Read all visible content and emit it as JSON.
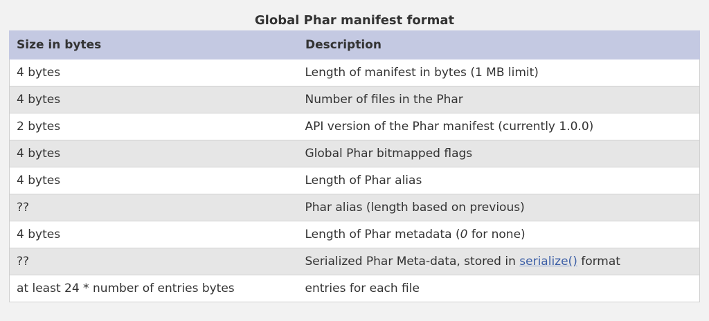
{
  "caption": "Global Phar manifest format",
  "columns": {
    "size": "Size in bytes",
    "description": "Description"
  },
  "rows": [
    {
      "size": "4 bytes",
      "description": "Length of manifest in bytes (1 MB limit)"
    },
    {
      "size": "4 bytes",
      "description": "Number of files in the Phar"
    },
    {
      "size": "2 bytes",
      "description": "API version of the Phar manifest (currently 1.0.0)"
    },
    {
      "size": "4 bytes",
      "description": "Global Phar bitmapped flags"
    },
    {
      "size": "4 bytes",
      "description": "Length of Phar alias"
    },
    {
      "size": "??",
      "description": "Phar alias (length based on previous)"
    },
    {
      "size": "4 bytes",
      "description_before": "Length of Phar metadata (",
      "description_em": "0",
      "description_after": " for none)"
    },
    {
      "size": "??",
      "description_before": "Serialized Phar Meta-data, stored in ",
      "description_link": "serialize()",
      "description_after": " format"
    },
    {
      "size": "at least 24 * number of entries bytes",
      "description": "entries for each file"
    }
  ],
  "colors": {
    "header_bg": "#c4c9e2",
    "row_alt": "#e6e6e6",
    "link": "#3b5ea6"
  }
}
